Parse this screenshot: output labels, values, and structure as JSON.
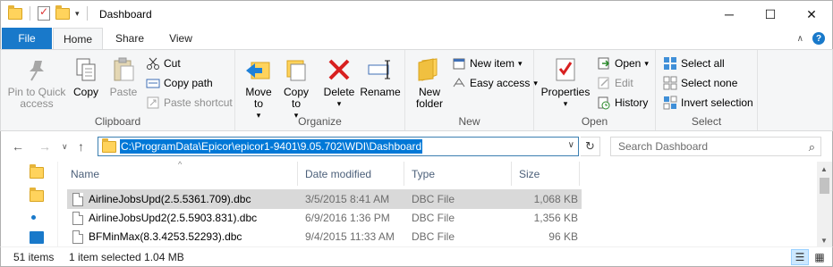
{
  "window": {
    "title": "Dashboard",
    "minimize": "─",
    "maximize": "☐",
    "close": "✕"
  },
  "tabs": {
    "file": "File",
    "home": "Home",
    "share": "Share",
    "view": "View"
  },
  "ribbon": {
    "clipboard": {
      "label": "Clipboard",
      "pin": "Pin to Quick access",
      "copy": "Copy",
      "paste": "Paste",
      "cut": "Cut",
      "copy_path": "Copy path",
      "paste_shortcut": "Paste shortcut"
    },
    "organize": {
      "label": "Organize",
      "move_to": "Move to",
      "copy_to": "Copy to",
      "delete": "Delete",
      "rename": "Rename"
    },
    "new": {
      "label": "New",
      "new_folder": "New folder",
      "new_item": "New item",
      "easy_access": "Easy access"
    },
    "open": {
      "label": "Open",
      "properties": "Properties",
      "open": "Open",
      "edit": "Edit",
      "history": "History"
    },
    "select": {
      "label": "Select",
      "select_all": "Select all",
      "select_none": "Select none",
      "invert_selection": "Invert selection"
    }
  },
  "nav": {
    "address": "C:\\ProgramData\\Epicor\\epicor1-9401\\9.05.702\\WDI\\Dashboard",
    "search_placeholder": "Search Dashboard"
  },
  "columns": {
    "name": "Name",
    "date": "Date modified",
    "type": "Type",
    "size": "Size"
  },
  "files": [
    {
      "name": "AirlineJobsUpd(2.5.5361.709).dbc",
      "date": "3/5/2015 8:41 AM",
      "type": "DBC File",
      "size": "1,068 KB",
      "selected": true
    },
    {
      "name": "AirlineJobsUpd2(2.5.5903.831).dbc",
      "date": "6/9/2016 1:36 PM",
      "type": "DBC File",
      "size": "1,356 KB",
      "selected": false
    },
    {
      "name": "BFMinMax(8.3.4253.52293).dbc",
      "date": "9/4/2015 11:33 AM",
      "type": "DBC File",
      "size": "96 KB",
      "selected": false
    }
  ],
  "status": {
    "items": "51 items",
    "selected": "1 item selected  1.04 MB"
  },
  "colors": {
    "accent": "#1979ca",
    "selection": "#d9d9d9",
    "address_highlight": "#0078d7"
  }
}
